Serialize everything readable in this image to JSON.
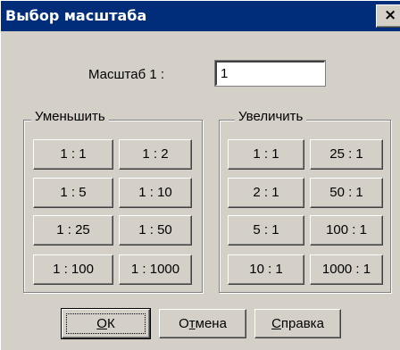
{
  "window": {
    "title": "Выбор масштаба",
    "close_label": "×"
  },
  "scale": {
    "label": "Масштаб 1 :",
    "value": "1"
  },
  "decrease": {
    "legend": "Уменьшить",
    "buttons": [
      "1 : 1",
      "1 : 2",
      "1 : 5",
      "1 : 10",
      "1 : 25",
      "1 : 50",
      "1 : 100",
      "1 : 1000"
    ]
  },
  "increase": {
    "legend": "Увеличить",
    "buttons": [
      "1 : 1",
      "25 : 1",
      "2 : 1",
      "50 : 1",
      "5 : 1",
      "100 : 1",
      "10 : 1",
      "1000 : 1"
    ]
  },
  "footer": {
    "ok": {
      "mnemonic": "О",
      "rest": "К"
    },
    "cancel": {
      "before": "О",
      "mnemonic": "т",
      "rest": "мена"
    },
    "help": {
      "mnemonic": "С",
      "rest": "правка"
    }
  },
  "colors": {
    "titlebar": "#002d7a",
    "face": "#d4d0c8",
    "shadow": "#808080",
    "dark_shadow": "#404040",
    "highlight": "#ffffff"
  }
}
